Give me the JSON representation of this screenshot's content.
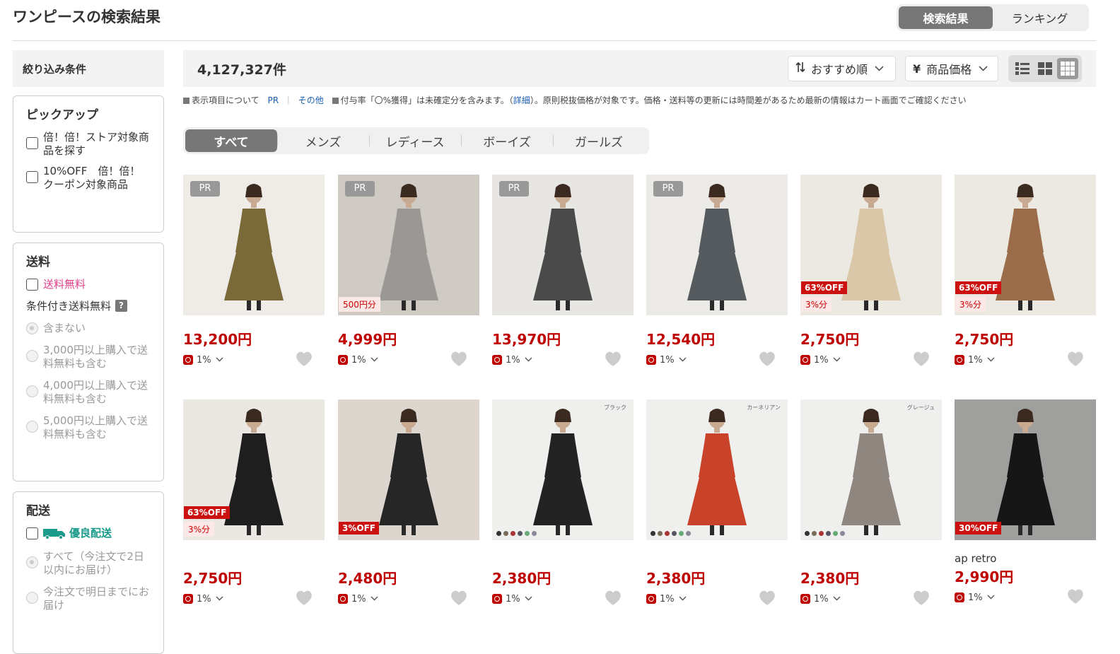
{
  "page": {
    "title": "ワンピースの検索結果"
  },
  "top_toggle": {
    "results": "検索結果",
    "ranking": "ランキング"
  },
  "sidebar": {
    "header": "絞り込み条件",
    "pickup": {
      "title": "ピックアップ",
      "items": [
        "倍！倍！ストア対象商品を探す",
        "10%OFF　倍！倍！クーポン対象商品"
      ]
    },
    "shipping": {
      "title": "送料",
      "free": "送料無料",
      "conditional_label": "条件付き送料無料",
      "help": "?",
      "options": [
        "含まない",
        "3,000円以上購入で送料無料も含む",
        "4,000円以上購入で送料無料も含む",
        "5,000円以上購入で送料無料も含む"
      ]
    },
    "delivery": {
      "title": "配送",
      "premium": "優良配送",
      "options": [
        "すべて（今注文で2日以内にお届け）",
        "今注文で明日までにお届け"
      ]
    }
  },
  "toolbar": {
    "count": "4,127,327件",
    "sort": "おすすめ順",
    "price_filter": "商品価格",
    "price_prefix": "¥"
  },
  "notice": {
    "part1": "表示項目について",
    "pr": "PR",
    "sep": "｜",
    "other": "その他",
    "part2": "付与率「〇%獲得」は未確定分を含みます。（",
    "detail": "詳細",
    "part3": "）。原則税抜価格が対象です。価格・送料等の更新には時間差があるため最新の情報はカート画面でご確認ください"
  },
  "tabs": [
    "すべて",
    "メンズ",
    "レディース",
    "ボーイズ",
    "ガールズ"
  ],
  "products": [
    {
      "price": "13,200円",
      "point": "1%",
      "pr": "PR",
      "off": "",
      "pts": "",
      "shop": "",
      "img_bg": "#efece7",
      "dress": "#7a6a3a"
    },
    {
      "price": "4,999円",
      "point": "1%",
      "pr": "PR",
      "off": "",
      "pts": "500円分",
      "shop": "",
      "img_bg": "#cfcac4",
      "dress": "#9a9894"
    },
    {
      "price": "13,970円",
      "point": "1%",
      "pr": "PR",
      "off": "",
      "pts": "",
      "shop": "",
      "img_bg": "#e8e6e3",
      "dress": "#4a4a4a"
    },
    {
      "price": "12,540円",
      "point": "1%",
      "pr": "PR",
      "off": "",
      "pts": "",
      "shop": "",
      "img_bg": "#eceae7",
      "dress": "#555a5e"
    },
    {
      "price": "2,750円",
      "point": "1%",
      "pr": "",
      "off": "63%OFF",
      "pts": "3%分",
      "shop": "",
      "img_bg": "#ece8e2",
      "dress": "#d9c7a8"
    },
    {
      "price": "2,750円",
      "point": "1%",
      "pr": "",
      "off": "63%OFF",
      "pts": "3%分",
      "shop": "",
      "img_bg": "#ece8e2",
      "dress": "#9a6c4a"
    },
    {
      "price": "2,750円",
      "point": "1%",
      "pr": "",
      "off": "63%OFF",
      "pts": "3%分",
      "shop": "",
      "img_bg": "#ebe7e2",
      "dress": "#1e1e1e"
    },
    {
      "price": "2,480円",
      "point": "1%",
      "pr": "",
      "off": "3%OFF",
      "pts": "",
      "shop": "",
      "img_bg": "#ddd6cf",
      "dress": "#262626"
    },
    {
      "price": "2,380円",
      "point": "1%",
      "pr": "",
      "off": "",
      "pts": "",
      "shop": "",
      "img_bg": "#efefed",
      "dress": "#232323",
      "tag": "ブラック"
    },
    {
      "price": "2,380円",
      "point": "1%",
      "pr": "",
      "off": "",
      "pts": "",
      "shop": "",
      "img_bg": "#efefed",
      "dress": "#c9432a",
      "tag": "カーネリアン"
    },
    {
      "price": "2,380円",
      "point": "1%",
      "pr": "",
      "off": "",
      "pts": "",
      "shop": "",
      "img_bg": "#efefed",
      "dress": "#8f8680",
      "tag": "グレージュ"
    },
    {
      "price": "2,990円",
      "point": "1%",
      "pr": "",
      "off": "30%OFF",
      "pts": "",
      "shop": "ap retro",
      "img_bg": "#9fa09d",
      "dress": "#161616"
    }
  ]
}
